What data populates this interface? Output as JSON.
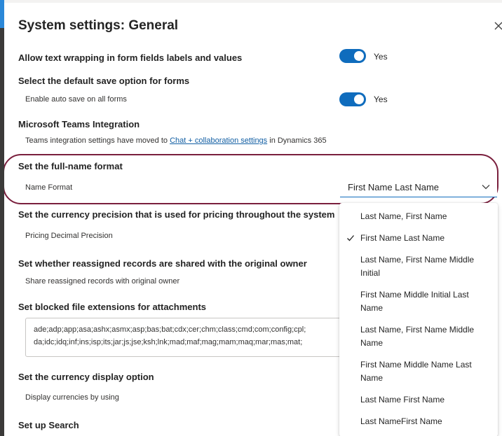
{
  "panel": {
    "title": "System settings: General"
  },
  "sections": {
    "wrapping": {
      "title": "Allow text wrapping in form fields labels and values",
      "toggle_label": "Yes"
    },
    "save": {
      "title": "Select the default save option for forms",
      "sub": "Enable auto save on all forms",
      "toggle_label": "Yes"
    },
    "teams": {
      "title": "Microsoft Teams Integration",
      "sub_prefix": "Teams integration settings have moved to ",
      "link": "Chat + collaboration settings",
      "sub_suffix": " in Dynamics 365"
    },
    "fullname": {
      "title": "Set the full-name format",
      "sub": "Name Format",
      "selected": "First Name Last Name"
    },
    "currency_precision": {
      "title": "Set the currency precision that is used for pricing throughout the system",
      "sub": "Pricing Decimal Precision"
    },
    "reassigned": {
      "title": "Set whether reassigned records are shared with the original owner",
      "sub": "Share reassigned records with original owner"
    },
    "blocked": {
      "title": "Set blocked file extensions for attachments",
      "line1": "ade;adp;app;asa;ashx;asmx;asp;bas;bat;cdx;cer;chm;class;cmd;com;config;cpl;",
      "line2": "da;idc;idq;inf;ins;isp;its;jar;js;jse;ksh;lnk;mad;maf;mag;mam;maq;mar;mas;mat;"
    },
    "currency_display": {
      "title": "Set the currency display option",
      "sub": "Display currencies by using"
    },
    "search": {
      "title": "Set up Search"
    }
  },
  "dropdown": {
    "options": [
      "Last Name, First Name",
      "First Name Last Name",
      "Last Name, First Name Middle Initial",
      "First Name Middle Initial Last Name",
      "Last Name, First Name Middle Name",
      "First Name Middle Name Last Name",
      "Last Name First Name",
      "Last NameFirst Name"
    ],
    "selected_index": 1
  },
  "icons": {
    "close": "close-icon",
    "chevron": "chevron-down-icon",
    "check": "checkmark-icon"
  },
  "colors": {
    "accent": "#0f6cbd",
    "highlight_ring": "#7a1f3d",
    "link": "#115ea3"
  }
}
